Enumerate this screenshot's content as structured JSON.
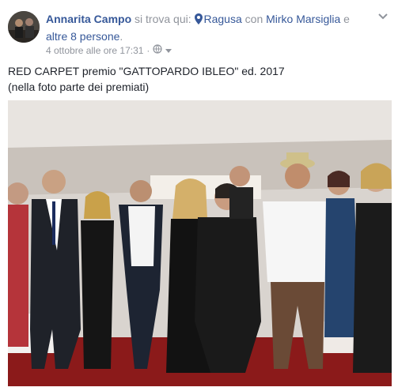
{
  "post": {
    "author": "Annarita Campo",
    "location_prefix": "si trova qui:",
    "location": "Ragusa",
    "with_prefix": "con",
    "tagged": "Mirko Marsiglia",
    "and_text": "e",
    "others": "altre 8 persone",
    "period": ".",
    "timestamp": "4 ottobre alle ore 17:31",
    "separator": "·",
    "caption_line1": "RED CARPET premio \"GATTOPARDO IBLEO\" ed. 2017",
    "caption_line2": "(nella foto parte dei premiati)"
  },
  "icons": {
    "location": "map-pin-icon",
    "privacy": "globe-icon",
    "options": "chevron-down-icon"
  },
  "colors": {
    "link": "#365899",
    "muted": "#90949c",
    "text": "#1d2129",
    "carpet": "#8b1a1a"
  }
}
